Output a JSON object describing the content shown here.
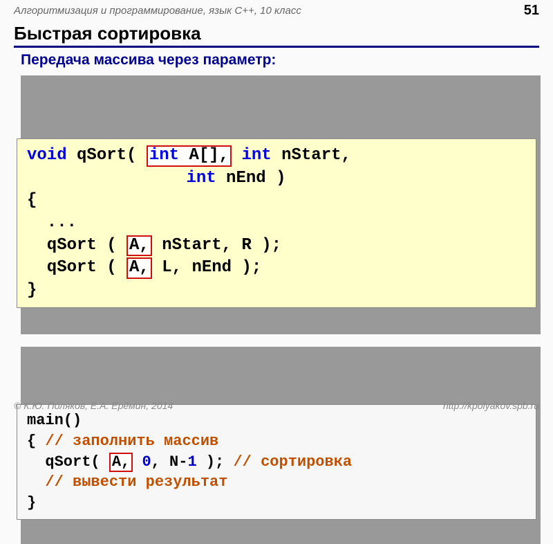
{
  "header": {
    "crumb": "Алгоритмизация и программирование, язык C++, 10 класс",
    "page": "51"
  },
  "title": "Быстрая сортировка",
  "subtitle": "Передача массива через параметр:",
  "code1": {
    "void": "void",
    "fn": " qSort( ",
    "int": "int",
    "arr": " A[],",
    "p1a": " nStart,",
    "indent2": "                ",
    "p2a": " nEnd )",
    "brace_o": "{",
    "dots": "  ...",
    "call1a": "  qSort ( ",
    "A1": "A,",
    "call1b": " nStart, R );",
    "call2a": "  qSort ( ",
    "A2": "A,",
    "call2b": " L, nEnd );",
    "brace_c": "}"
  },
  "code2": {
    "main": "main()",
    "l2a": "{ ",
    "c1": "// заполнить массив",
    "l3a": "  qSort( ",
    "A3": "A,",
    "sp": " ",
    "zero": "0",
    "mid": ", N-",
    "one": "1",
    "tail": " ); ",
    "c2": "// сортировка",
    "l4": "  ",
    "c3": "// вывести результат",
    "l5": "}"
  },
  "footer": {
    "left": "© К.Ю. Поляков, Е.А. Ерёмин, 2014",
    "right": "http://kpolyakov.spb.ru"
  }
}
